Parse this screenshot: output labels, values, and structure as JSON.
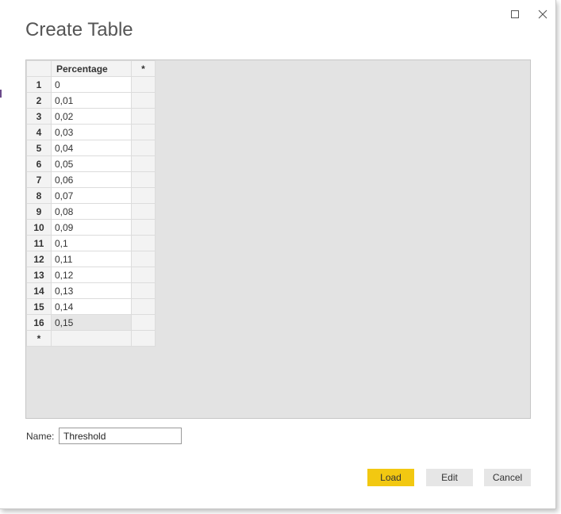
{
  "dialog": {
    "title": "Create Table",
    "maximize_icon": "maximize-icon",
    "close_icon": "close-icon"
  },
  "table": {
    "columns": [
      "Percentage",
      "*"
    ],
    "rows": [
      {
        "index": "1",
        "value": "0"
      },
      {
        "index": "2",
        "value": "0,01"
      },
      {
        "index": "3",
        "value": "0,02"
      },
      {
        "index": "4",
        "value": "0,03"
      },
      {
        "index": "5",
        "value": "0,04"
      },
      {
        "index": "6",
        "value": "0,05"
      },
      {
        "index": "7",
        "value": "0,06"
      },
      {
        "index": "8",
        "value": "0,07"
      },
      {
        "index": "9",
        "value": "0,08"
      },
      {
        "index": "10",
        "value": "0,09"
      },
      {
        "index": "11",
        "value": "0,1"
      },
      {
        "index": "12",
        "value": "0,11"
      },
      {
        "index": "13",
        "value": "0,12"
      },
      {
        "index": "14",
        "value": "0,13"
      },
      {
        "index": "15",
        "value": "0,14"
      },
      {
        "index": "16",
        "value": "0,15"
      }
    ],
    "new_row_marker": "*"
  },
  "name_field": {
    "label": "Name:",
    "value": "Threshold"
  },
  "buttons": {
    "load": "Load",
    "edit": "Edit",
    "cancel": "Cancel"
  },
  "colors": {
    "accent": "#f2c811"
  }
}
